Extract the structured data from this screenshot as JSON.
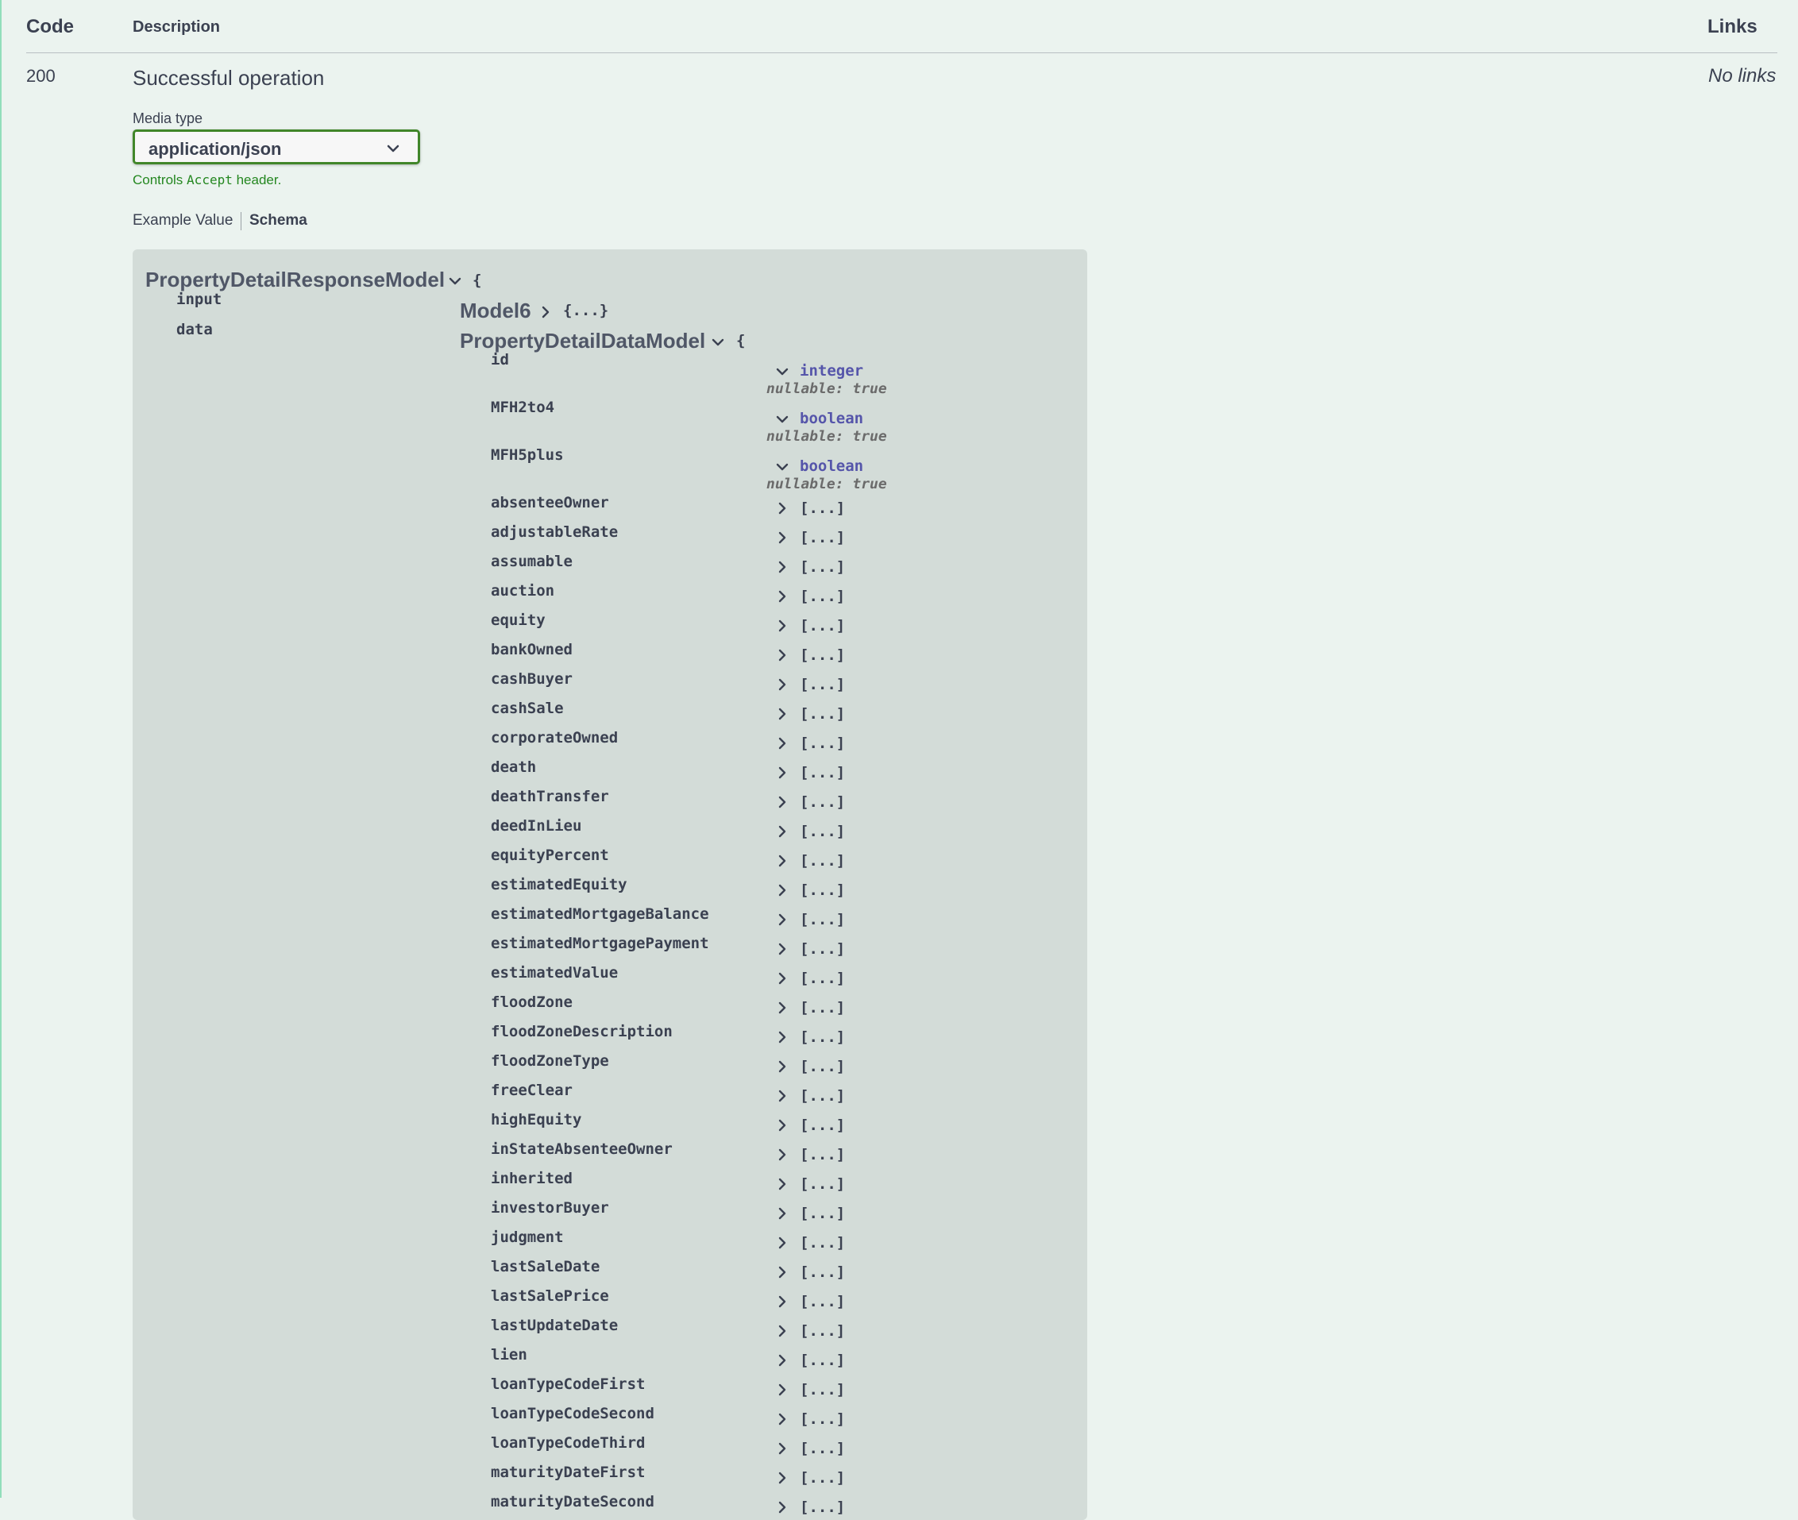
{
  "table_header": {
    "code": "Code",
    "description": "Description",
    "links": "Links"
  },
  "response": {
    "code": "200",
    "description": "Successful operation",
    "links": "No links",
    "media_type_label": "Media type",
    "media_type_value": "application/json",
    "controls_prefix": "Controls",
    "controls_code": "Accept",
    "controls_suffix": "header.",
    "tab_example": "Example Value",
    "tab_schema": "Schema"
  },
  "schema": {
    "root_model": "PropertyDetailResponseModel",
    "open_brace": "{",
    "input_key": "input",
    "input_model": "Model6",
    "input_collapsed": "{...}",
    "data_key": "data",
    "data_model": "PropertyDetailDataModel",
    "typed_properties": [
      {
        "name": "id",
        "type": "integer",
        "nullable": "nullable: true"
      },
      {
        "name": "MFH2to4",
        "type": "boolean",
        "nullable": "nullable: true"
      },
      {
        "name": "MFH5plus",
        "type": "boolean",
        "nullable": "nullable: true"
      }
    ],
    "collapsed_marker": "[...]",
    "collapsed_properties": [
      "absenteeOwner",
      "adjustableRate",
      "assumable",
      "auction",
      "equity",
      "bankOwned",
      "cashBuyer",
      "cashSale",
      "corporateOwned",
      "death",
      "deathTransfer",
      "deedInLieu",
      "equityPercent",
      "estimatedEquity",
      "estimatedMortgageBalance",
      "estimatedMortgagePayment",
      "estimatedValue",
      "floodZone",
      "floodZoneDescription",
      "floodZoneType",
      "freeClear",
      "highEquity",
      "inStateAbsenteeOwner",
      "inherited",
      "investorBuyer",
      "judgment",
      "lastSaleDate",
      "lastSalePrice",
      "lastUpdateDate",
      "lien",
      "loanTypeCodeFirst",
      "loanTypeCodeSecond",
      "loanTypeCodeThird",
      "maturityDateFirst",
      "maturityDateSecond"
    ]
  },
  "colors": {
    "background": "#ebf3ef",
    "select_border": "#41862a",
    "note_green": "#248720",
    "type_blue": "#5555aa",
    "schema_box": "#d3dcd8"
  },
  "icons": {
    "dropdown": "chevron-down-icon",
    "expanded": "chevron-down-icon",
    "collapsed": "chevron-right-icon"
  }
}
